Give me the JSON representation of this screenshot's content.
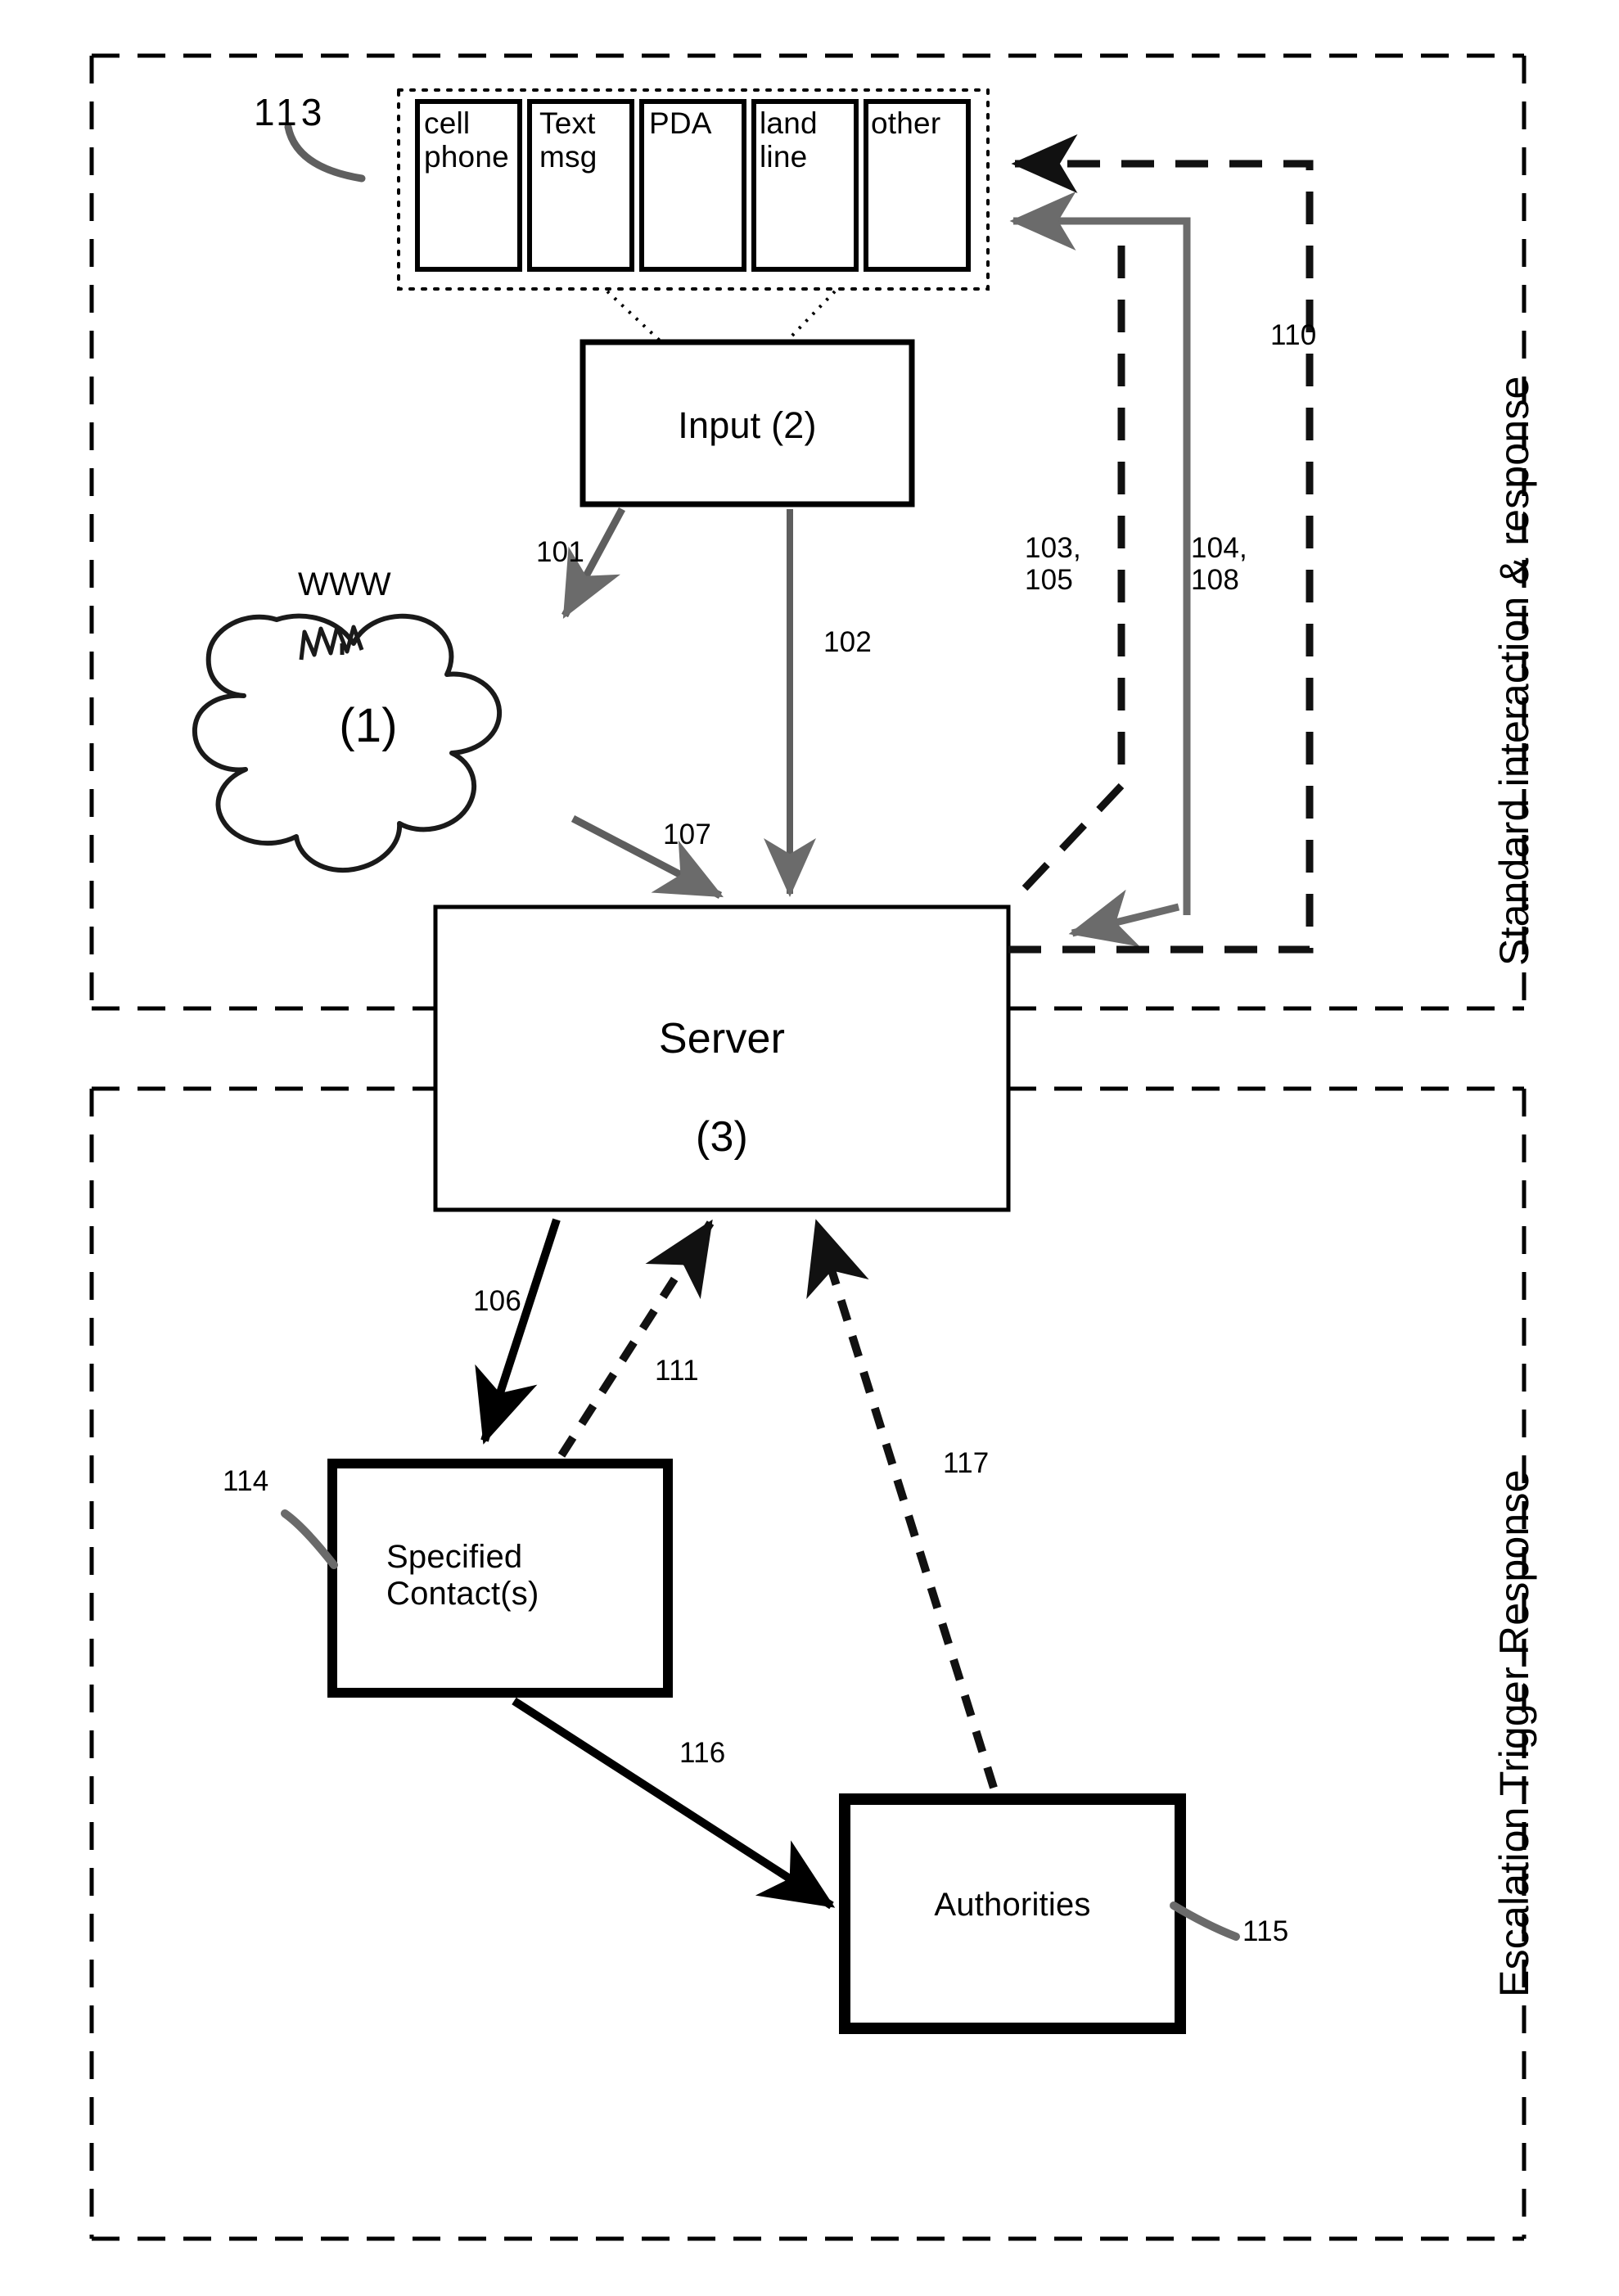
{
  "figure": {
    "title": "Standard interaction and escalation trigger response system diagram",
    "zones": {
      "top": {
        "label": "Standard interaction & response"
      },
      "bottom": {
        "label": "Escalation Trigger Response"
      }
    },
    "device_group": {
      "ref": "113",
      "devices": [
        {
          "label": "cell\nphone"
        },
        {
          "label": "Text\nmsg"
        },
        {
          "label": "PDA"
        },
        {
          "label": "land\nline"
        },
        {
          "label": "other"
        }
      ]
    },
    "nodes": {
      "input": {
        "label": "Input (2)"
      },
      "cloud": {
        "label": "(1)",
        "tag": "WWW"
      },
      "server": {
        "label": "Server",
        "sublabel": "(3)"
      },
      "contacts": {
        "label": "Specified\nContact(s)",
        "ref": "114"
      },
      "authorities": {
        "label": "Authorities",
        "ref": "115"
      }
    },
    "edge_labels": {
      "e101": "101",
      "e102": "102",
      "e103_105": "103,\n105",
      "e104_108": "104,\n108",
      "e107": "107",
      "e110": "110",
      "e106_": "106,",
      "e111": "111",
      "e116": "116",
      "e117": "117"
    },
    "colors": {
      "ink": "#000000",
      "gray_line": "#666666",
      "dashed": "#1a1a1a"
    }
  }
}
